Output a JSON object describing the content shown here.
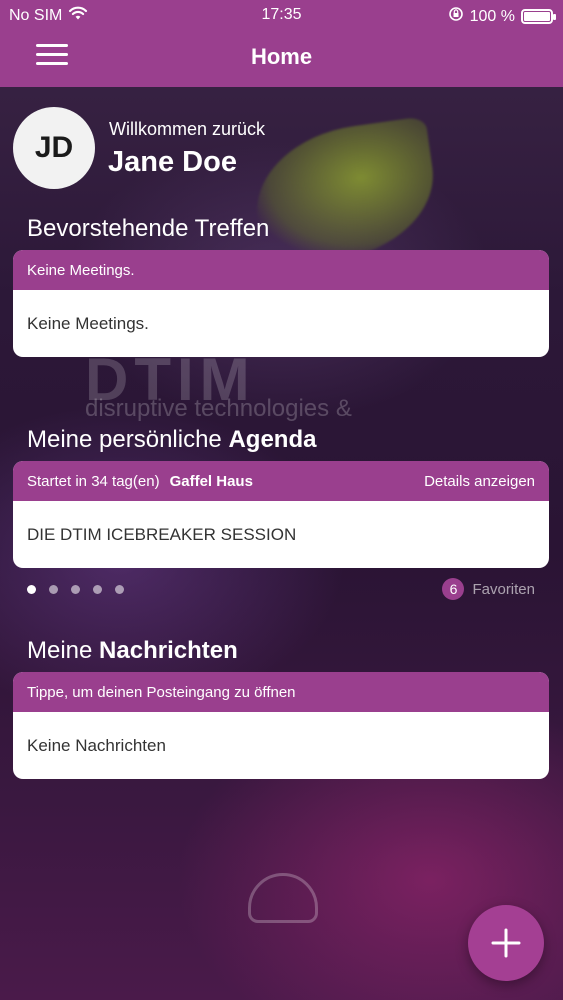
{
  "status_bar": {
    "carrier": "No SIM",
    "time": "17:35",
    "battery": "100 %"
  },
  "header": {
    "title": "Home"
  },
  "user": {
    "initials": "JD",
    "welcome": "Willkommen zurück",
    "name": "Jane Doe"
  },
  "meetings": {
    "title": "Bevorstehende Treffen",
    "header_text": "Keine Meetings.",
    "body_text": "Keine Meetings."
  },
  "agenda": {
    "title_prefix": "Meine persönliche",
    "title_bold": "Agenda",
    "starts_in": "Startet in 34 tag(en)",
    "location": "Gaffel Haus",
    "details_link": "Details anzeigen",
    "session": "DIE DTIM ICEBREAKER SESSION",
    "page_count": 5,
    "active_page": 1,
    "favorites_count": "6",
    "favorites_label": "Favoriten"
  },
  "messages": {
    "title_prefix": "Meine",
    "title_bold": "Nachrichten",
    "header_text": "Tippe, um deinen Posteingang zu öffnen",
    "body_text": "Keine Nachrichten"
  },
  "background": {
    "logo_text": "DTIM",
    "tagline": "disruptive technologies &"
  },
  "colors": {
    "accent": "#9a3f8e",
    "fab": "#a43f93"
  },
  "icons": {
    "menu": "hamburger-icon",
    "wifi": "wifi-icon",
    "orientation_lock": "orientation-lock-icon",
    "battery": "battery-icon",
    "add": "plus-icon"
  }
}
